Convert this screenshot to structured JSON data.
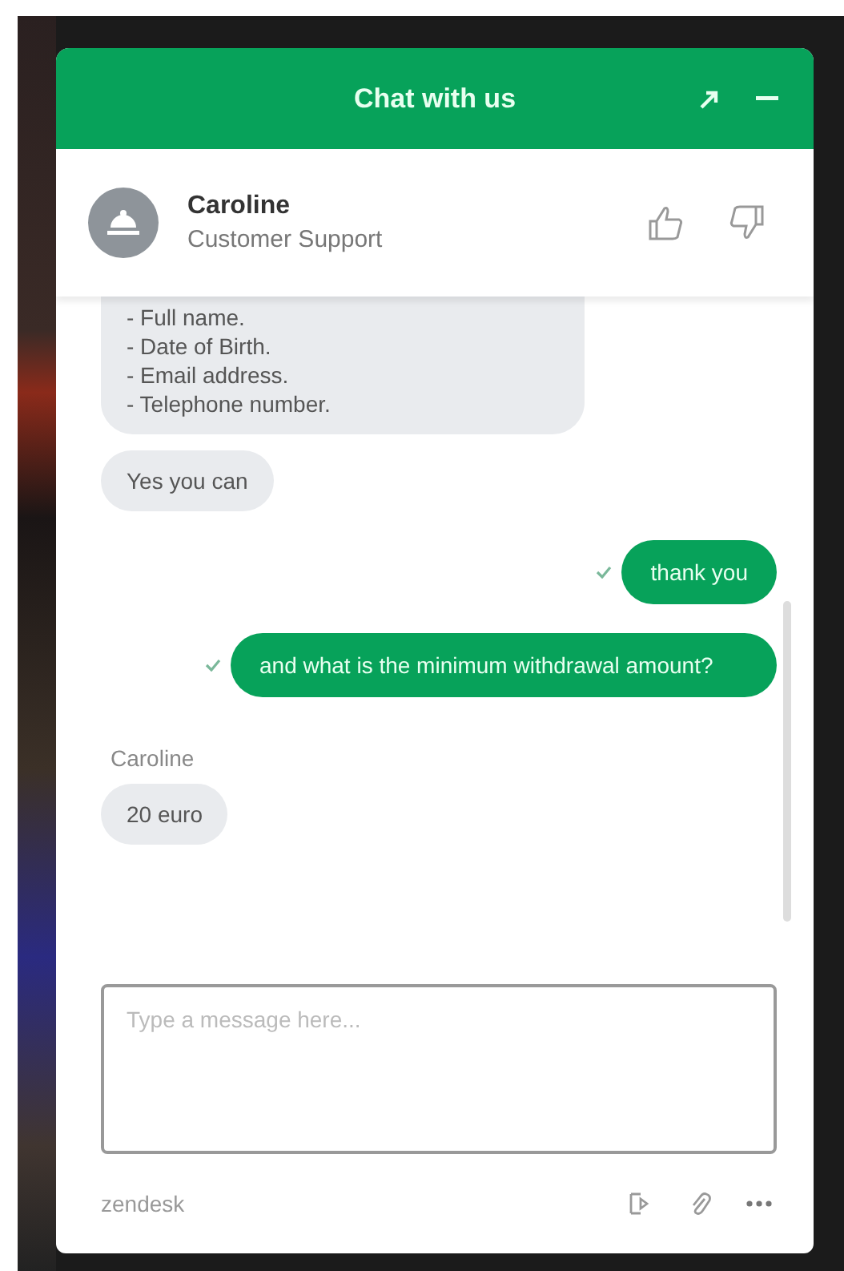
{
  "widget": {
    "title": "Chat with us"
  },
  "agent": {
    "name": "Caroline",
    "role": "Customer Support"
  },
  "messages": [
    {
      "kind": "agent",
      "text": "- Full name.\n- Date of Birth.\n- Email address.\n- Telephone number."
    },
    {
      "kind": "agent",
      "text": "Yes you can"
    },
    {
      "kind": "visitor",
      "text": "thank you",
      "delivered": true
    },
    {
      "kind": "visitor",
      "text": "and what is the minimum withdrawal amount?",
      "delivered": true
    },
    {
      "kind": "sender",
      "text": "Caroline"
    },
    {
      "kind": "agent",
      "text": "20 euro"
    }
  ],
  "composer": {
    "placeholder": "Type a message here..."
  },
  "footer": {
    "brand": "zendesk"
  }
}
